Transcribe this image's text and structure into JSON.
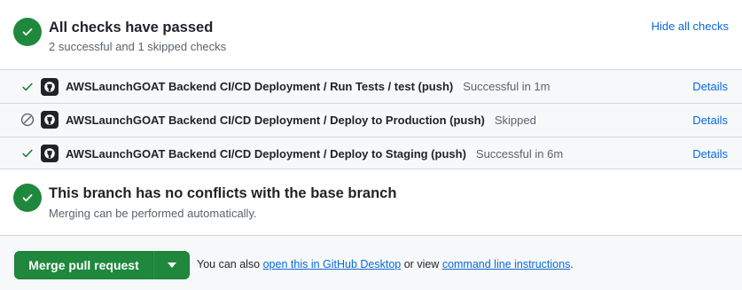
{
  "checks_summary": {
    "title": "All checks have passed",
    "subtitle": "2 successful and 1 skipped checks",
    "hide_link": "Hide all checks"
  },
  "checks": [
    {
      "status": "success",
      "name": "AWSLaunchGOAT Backend CI/CD Deployment / Run Tests / test (push)",
      "status_text": "Successful in 1m",
      "details": "Details"
    },
    {
      "status": "skipped",
      "name": "AWSLaunchGOAT Backend CI/CD Deployment / Deploy to Production (push)",
      "status_text": "Skipped",
      "details": "Details"
    },
    {
      "status": "success",
      "name": "AWSLaunchGOAT Backend CI/CD Deployment / Deploy to Staging (push)",
      "status_text": "Successful in 6m",
      "details": "Details"
    }
  ],
  "conflicts": {
    "title": "This branch has no conflicts with the base branch",
    "subtitle": "Merging can be performed automatically."
  },
  "merge": {
    "button_label": "Merge pull request",
    "text_prefix": "You can also",
    "desktop_link": "open this in GitHub Desktop",
    "text_middle": "or view",
    "cli_link": "command line instructions",
    "text_suffix": "."
  },
  "colors": {
    "success_green": "#1f883d",
    "link_blue": "#0969da",
    "muted_text": "#59636e",
    "border": "#d1d9e0",
    "footer_bg": "#f6f8fa"
  },
  "icons": {
    "summary_status": "check-circle-fill-icon",
    "row_success": "check-icon",
    "row_skipped": "skip-icon",
    "row_avatar": "github-mark-icon",
    "merge_dropdown": "triangle-down-icon"
  }
}
